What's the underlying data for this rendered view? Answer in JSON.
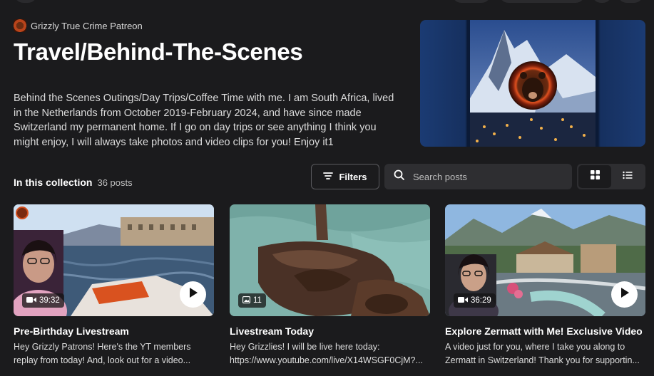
{
  "creator": {
    "name": "Grizzly True Crime Patreon"
  },
  "collection": {
    "title": "Travel/Behind-The-Scenes",
    "description": "Behind the Scenes Outings/Day Trips/Coffee Time with me. I am South Africa, lived in the Netherlands from October 2019-February 2024, and have since made Switzerland my permanent home. If I go on day trips or see anything I think you might enjoy, I will always take photos and video clips for you! Enjoy it1",
    "label": "In this collection",
    "count": "36 posts"
  },
  "toolbar": {
    "filters_label": "Filters",
    "search_placeholder": "Search posts",
    "view_grid_icon": "grid-icon",
    "view_list_icon": "list-icon"
  },
  "posts": [
    {
      "title": "Pre-Birthday Livestream",
      "excerpt_line1": "Hey Grizzly Patrons! Here's the YT members",
      "excerpt_line2": "replay from today! And, look out for a video...",
      "media_type": "video",
      "badge": "39:32"
    },
    {
      "title": "Livestream Today",
      "excerpt_line1": "Hey Grizzlies! I will be live here today:",
      "excerpt_line2": "https://www.youtube.com/live/X14WSGF0CjM?...",
      "media_type": "images",
      "badge": "11"
    },
    {
      "title": "Explore Zermatt with Me! Exclusive Video",
      "excerpt_line1": "A video just for you, where I take you along to",
      "excerpt_line2": "Zermatt in Switzerland! Thank you for supportin...",
      "media_type": "video",
      "badge": "36:29"
    }
  ]
}
